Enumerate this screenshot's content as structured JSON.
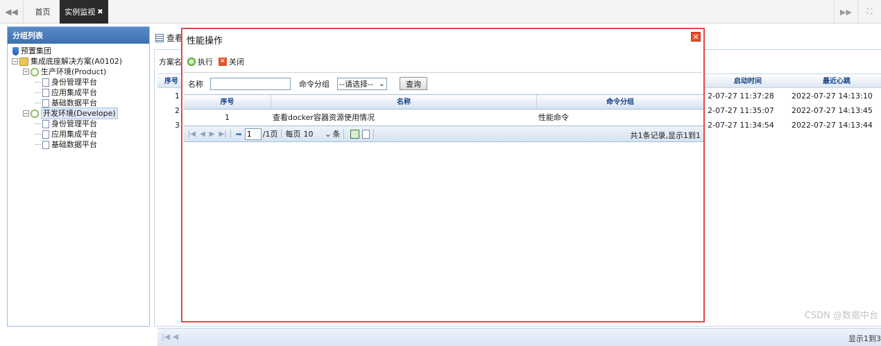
{
  "topbar": {
    "nav_prev": "◀◀",
    "home_tab": "首页",
    "active_tab": "实例监视",
    "active_tab_close": "✖",
    "nav_next": "▶▶",
    "fullscreen": "⛶",
    "settings": "⚙"
  },
  "left_panel": {
    "title": "分组列表",
    "tree": [
      {
        "label": "预置集团"
      },
      {
        "label": "集成底座解决方案(A0102)"
      },
      {
        "label": "生产环境(Product)"
      },
      {
        "label": "身份管理平台"
      },
      {
        "label": "应用集成平台"
      },
      {
        "label": "基础数据平台"
      },
      {
        "label": "开发环境(Develope)"
      },
      {
        "label": "身份管理平台"
      },
      {
        "label": "应用集成平台"
      },
      {
        "label": "基础数据平台"
      }
    ]
  },
  "main": {
    "title_fragment": "查看",
    "toolbar_label_fragment": "方案名",
    "grid_header": {
      "seq": "序号",
      "start_time": "启动时间",
      "heartbeat": "最近心跳"
    },
    "rows": [
      {
        "seq": "1",
        "start_time": "2-07-27 11:37:28",
        "heartbeat": "2022-07-27 14:13:10"
      },
      {
        "seq": "2",
        "start_time": "2-07-27 11:35:07",
        "heartbeat": "2022-07-27 14:13:45"
      },
      {
        "seq": "3",
        "start_time": "2-07-27 11:34:54",
        "heartbeat": "2022-07-27 14:13:44"
      }
    ],
    "pager_first": "|◀  ◀",
    "pager_info_fragment": "显示1到3"
  },
  "dialog": {
    "title": "性能操作",
    "close": "✕",
    "toolbar": {
      "execute": "执行",
      "close": "关闭",
      "close_glyph": "✕"
    },
    "search": {
      "name_label": "名称",
      "name_value": "",
      "group_label": "命令分组",
      "group_selected": "--请选择--",
      "dropdown_glyph": "⌄",
      "query_button": "查询"
    },
    "grid_header": {
      "seq": "序号",
      "name": "名称",
      "group": "命令分组"
    },
    "rows": [
      {
        "seq": "1",
        "name": "查看docker容器资源使用情况",
        "group": "性能命令"
      }
    ],
    "pager": {
      "first": "|◀",
      "prev": "◀",
      "next": "▶",
      "last": "▶|",
      "go": "➡",
      "page": "1",
      "total_pages": "/1页",
      "per_page_label": "每页",
      "per_page_value": "10",
      "per_page_unit": "条",
      "info": "共1条记录,显示1到1"
    }
  },
  "watermark": "CSDN @数据中台"
}
